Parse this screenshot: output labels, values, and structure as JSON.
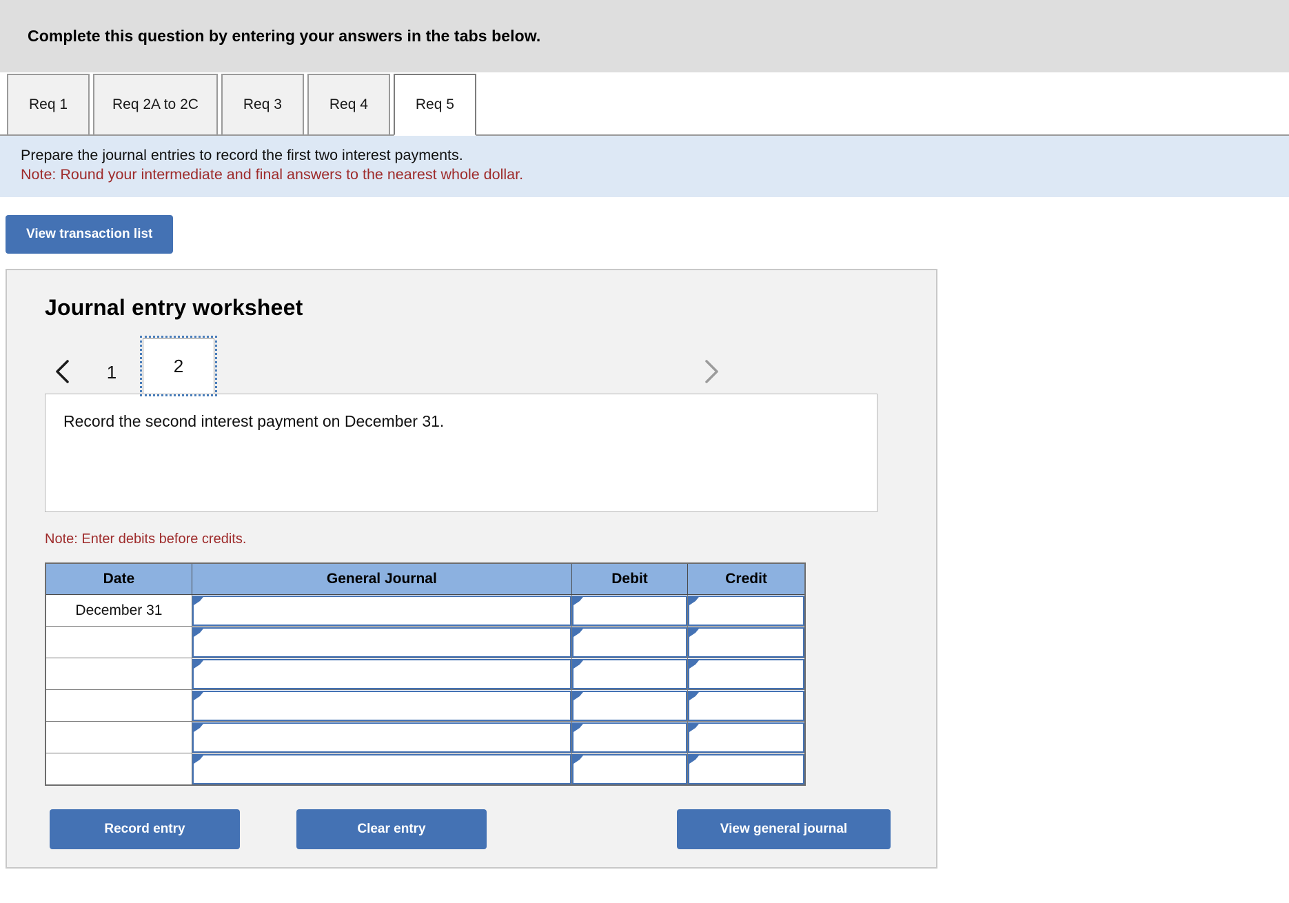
{
  "header": {
    "instruction": "Complete this question by entering your answers in the tabs below."
  },
  "tabs": [
    {
      "label": "Req 1",
      "active": false
    },
    {
      "label": "Req 2A to 2C",
      "active": false
    },
    {
      "label": "Req 3",
      "active": false
    },
    {
      "label": "Req 4",
      "active": false
    },
    {
      "label": "Req 5",
      "active": true
    }
  ],
  "instructions": {
    "line1": "Prepare the journal entries to record the first two interest payments.",
    "note": "Note: Round your intermediate and final answers to the nearest whole dollar."
  },
  "toolbar": {
    "view_transaction_list": "View transaction list"
  },
  "worksheet": {
    "title": "Journal entry worksheet",
    "pager": {
      "prev_icon": "chevron-left-icon",
      "next_icon": "chevron-right-icon",
      "pages": [
        "1",
        "2"
      ],
      "selected_page": "2"
    },
    "description": "Record the second interest payment on December 31.",
    "note": "Note: Enter debits before credits.",
    "table": {
      "columns": [
        "Date",
        "General Journal",
        "Debit",
        "Credit"
      ],
      "rows": [
        {
          "date": "December 31",
          "general_journal": "",
          "debit": "",
          "credit": ""
        },
        {
          "date": "",
          "general_journal": "",
          "debit": "",
          "credit": ""
        },
        {
          "date": "",
          "general_journal": "",
          "debit": "",
          "credit": ""
        },
        {
          "date": "",
          "general_journal": "",
          "debit": "",
          "credit": ""
        },
        {
          "date": "",
          "general_journal": "",
          "debit": "",
          "credit": ""
        },
        {
          "date": "",
          "general_journal": "",
          "debit": "",
          "credit": ""
        }
      ]
    },
    "actions": {
      "record_entry": "Record entry",
      "clear_entry": "Clear entry",
      "view_general_journal": "View general journal"
    }
  },
  "colors": {
    "accent_blue": "#4472b4",
    "table_header_blue": "#8cb1e0",
    "banner_gray": "#dedede",
    "instruction_blue": "#dde8f5",
    "note_red": "#9e2b2b"
  }
}
